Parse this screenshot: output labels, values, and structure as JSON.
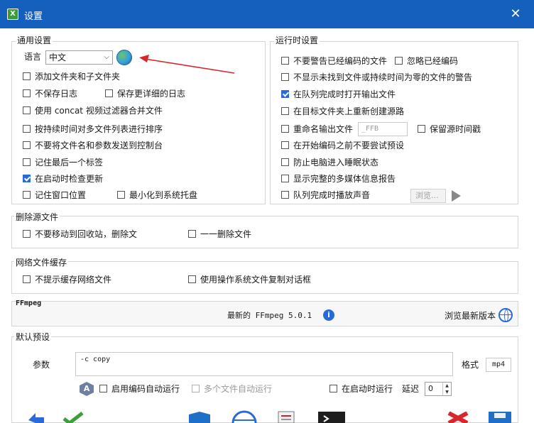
{
  "window": {
    "title": "设置",
    "app_icon_letter": "X",
    "close_glyph": "✕"
  },
  "general": {
    "title": "通用设置",
    "language_label": "语言",
    "language_value": "中文",
    "checkboxes": {
      "add_folders": {
        "label": "添加文件夹和子文件夹",
        "checked": false
      },
      "no_log": {
        "label": "不保存日志",
        "checked": false
      },
      "detailed_log": {
        "label": "保存更详细的日志",
        "checked": false
      },
      "concat": {
        "label": "使用 concat 视频过滤器合并文件",
        "checked": false
      },
      "sort_duration": {
        "label": "按持续时间对多文件列表进行排序",
        "checked": false
      },
      "no_console": {
        "label": "不要将文件名和参数发送到控制台",
        "checked": false
      },
      "remember_tab": {
        "label": "记住最后一个标签",
        "checked": false
      },
      "check_updates": {
        "label": "在启动时检查更新",
        "checked": true
      },
      "remember_pos": {
        "label": "记住窗口位置",
        "checked": false
      },
      "minimize_tray": {
        "label": "最小化到系统托盘",
        "checked": false
      }
    }
  },
  "runtime": {
    "title": "运行时设置",
    "checkboxes": {
      "no_warn_encoded": {
        "label": "不要警告已经编码的文件",
        "checked": false
      },
      "ignore_encoded": {
        "label": "忽略已经编码",
        "checked": false
      },
      "no_warn_missing": {
        "label": "不显示未找到文件或持续时间为零的文件的警告",
        "checked": false
      },
      "open_output": {
        "label": "在队列完成时打开输出文件",
        "checked": true
      },
      "recreate_path": {
        "label": "在目标文件夹上重新创建源路",
        "checked": false
      },
      "rename_output": {
        "label": "重命名输出文件",
        "checked": false
      },
      "keep_timestamp": {
        "label": "保留源时间戳",
        "checked": false
      },
      "no_try_preset": {
        "label": "在开始编码之前不要尝试预设",
        "checked": false
      },
      "prevent_sleep": {
        "label": "防止电脑进入睡眠状态",
        "checked": false
      },
      "full_media_info": {
        "label": "显示完整的多媒体信息报告",
        "checked": false
      },
      "play_sound": {
        "label": "队列完成时播放声音",
        "checked": false
      }
    },
    "suffix_placeholder": "_FFB",
    "browse_label": "浏览..."
  },
  "delete_source": {
    "title": "删除源文件",
    "checkboxes": {
      "no_recycle": {
        "label": "不要移动到回收站，删除文",
        "checked": false
      },
      "delete_one": {
        "label": "一一删除文件",
        "checked": false
      }
    }
  },
  "network_cache": {
    "title": "网络文件缓存",
    "checkboxes": {
      "no_prompt_cache": {
        "label": "不提示缓存网络文件",
        "checked": false
      },
      "os_copy_dialog": {
        "label": "使用操作系统文件复制对话框",
        "checked": false
      }
    }
  },
  "ffmpeg": {
    "title": "FFmpeg",
    "latest_label": "最新的 FFmpeg 5.0.1",
    "browse_latest": "浏览最新版本",
    "info_glyph": "i"
  },
  "preset": {
    "title": "默认预设",
    "params_label": "参数",
    "params_value": "-c copy",
    "format_label": "格式",
    "format_value": "mp4",
    "a_icon_letter": "A",
    "checkboxes": {
      "auto_run_enable": {
        "label": "启用编码自动运行",
        "checked": false
      },
      "multi_auto_run": {
        "label": "多个文件自动运行",
        "checked": false
      },
      "run_at_startup": {
        "label": "在启动时运行",
        "checked": false
      }
    },
    "delay_label": "延迟",
    "delay_value": "0"
  },
  "colors": {
    "titlebar": "#1560bd",
    "accent": "#2a6ad8",
    "arrow": "#d9262c"
  }
}
